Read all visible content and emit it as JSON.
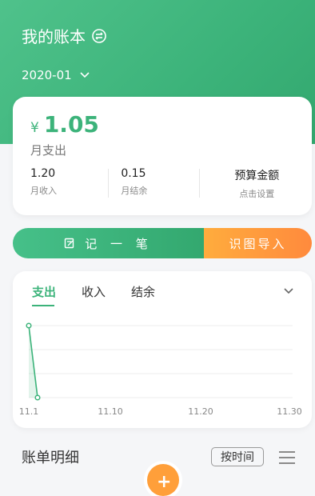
{
  "header": {
    "title": "我的账本",
    "month": "2020-01"
  },
  "summary": {
    "currency": "¥",
    "amount": "1.05",
    "amount_label": "月支出",
    "income_value": "1.20",
    "income_label": "月收入",
    "balance_value": "0.15",
    "balance_label": "月结余",
    "budget_title": "预算金额",
    "budget_hint": "点击设置"
  },
  "actions": {
    "record_label": "记 一 笔",
    "ocr_label": "识图导入"
  },
  "chart_tabs": {
    "expense": "支出",
    "income": "收入",
    "balance": "结余"
  },
  "chart_data": {
    "type": "line",
    "x": [
      "11.1",
      "11.10",
      "11.20",
      "11.30"
    ],
    "series": [
      {
        "values": [
          1.0,
          0.0
        ]
      }
    ],
    "xticks": [
      "11.1",
      "11.10",
      "11.20",
      "11.30"
    ],
    "grid": true,
    "accent": "#3cb37a"
  },
  "ledger": {
    "title": "账单明细",
    "sort_label": "按时间"
  },
  "colors": {
    "green": "#3cb37a",
    "orange": "#ff8a3d"
  }
}
